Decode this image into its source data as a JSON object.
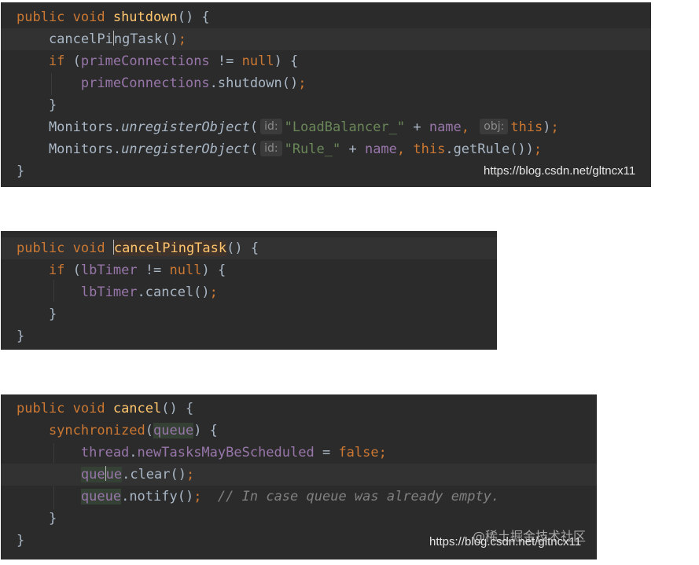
{
  "panels": [
    {
      "name": "shutdown",
      "lines": [
        [
          [
            "kw",
            "public void "
          ],
          [
            "fn",
            "shutdown"
          ],
          [
            "plain",
            "() {"
          ]
        ],
        [
          [
            "plain",
            "    cancelPi"
          ],
          [
            "caret",
            ""
          ],
          [
            "plain",
            "ngTask()"
          ],
          [
            "kw",
            ";"
          ]
        ],
        [
          [
            "kw",
            "    if "
          ],
          [
            "plain",
            "("
          ],
          [
            "field",
            "primeConnections"
          ],
          [
            "plain",
            " != "
          ],
          [
            "kw",
            "null"
          ],
          [
            "plain",
            ") {"
          ]
        ],
        [
          [
            "field",
            "        primeConnections"
          ],
          [
            "plain",
            ".shutdown()"
          ],
          [
            "kw",
            ";"
          ]
        ],
        [
          [
            "plain",
            "    }"
          ]
        ],
        [
          [
            "plain",
            "    Monitors."
          ],
          [
            "italic",
            "unregisterObject"
          ],
          [
            "plain",
            "("
          ],
          [
            "hint",
            "id:"
          ],
          [
            "str",
            "\"LoadBalancer_\""
          ],
          [
            "plain",
            " + "
          ],
          [
            "field",
            "name"
          ],
          [
            "kw",
            ", "
          ],
          [
            "hint",
            "obj:"
          ],
          [
            "kw",
            "this"
          ],
          [
            "plain",
            ")"
          ],
          [
            "kw",
            ";"
          ]
        ],
        [
          [
            "plain",
            "    Monitors."
          ],
          [
            "italic",
            "unregisterObject"
          ],
          [
            "plain",
            "("
          ],
          [
            "hint",
            "id:"
          ],
          [
            "str",
            "\"Rule_\""
          ],
          [
            "plain",
            " + "
          ],
          [
            "field",
            "name"
          ],
          [
            "kw",
            ", this"
          ],
          [
            "plain",
            ".getRule())"
          ],
          [
            "kw",
            ";"
          ]
        ],
        [
          [
            "plain",
            "}"
          ]
        ]
      ],
      "watermark": "https://blog.csdn.net/gltncx11"
    },
    {
      "name": "cancelPingTask",
      "lines": [
        [
          [
            "kw",
            "public void "
          ],
          [
            "caret",
            ""
          ],
          [
            "fndef",
            "cancelPingTask"
          ],
          [
            "plain",
            "() {"
          ]
        ],
        [
          [
            "kw",
            "    if "
          ],
          [
            "plain",
            "("
          ],
          [
            "field",
            "lbTimer"
          ],
          [
            "plain",
            " != "
          ],
          [
            "kw",
            "null"
          ],
          [
            "plain",
            ") {"
          ]
        ],
        [
          [
            "field",
            "        lbTimer"
          ],
          [
            "plain",
            ".cancel()"
          ],
          [
            "kw",
            ";"
          ]
        ],
        [
          [
            "plain",
            "    }"
          ]
        ],
        [
          [
            "plain",
            "}"
          ]
        ]
      ]
    },
    {
      "name": "cancel",
      "lines": [
        [
          [
            "kw",
            "public void "
          ],
          [
            "fn",
            "cancel"
          ],
          [
            "plain",
            "() {"
          ]
        ],
        [
          [
            "kw",
            "    synchronized"
          ],
          [
            "plain",
            "("
          ],
          [
            "fieldhl",
            "queue"
          ],
          [
            "plain",
            ") {"
          ]
        ],
        [
          [
            "field",
            "        thread"
          ],
          [
            "plain",
            "."
          ],
          [
            "field",
            "newTasksMayBeScheduled"
          ],
          [
            "plain",
            " = "
          ],
          [
            "kw",
            "false;"
          ]
        ],
        [
          [
            "plain",
            "        "
          ],
          [
            "fieldhl",
            "que"
          ],
          [
            "caret",
            ""
          ],
          [
            "fieldhl",
            "ue"
          ],
          [
            "plain",
            ".clear()"
          ],
          [
            "kw",
            ";"
          ]
        ],
        [
          [
            "plain",
            "        "
          ],
          [
            "fieldhl",
            "queue"
          ],
          [
            "plain",
            ".notify()"
          ],
          [
            "kw",
            ";  "
          ],
          [
            "comment",
            "// In case queue was already empty."
          ]
        ],
        [
          [
            "plain",
            "    }"
          ]
        ],
        [
          [
            "plain",
            "}"
          ]
        ]
      ],
      "watermark": "https://blog.csdn.net/gltncx11",
      "watermark_juejin": "@稀土掘金技术社区"
    }
  ]
}
